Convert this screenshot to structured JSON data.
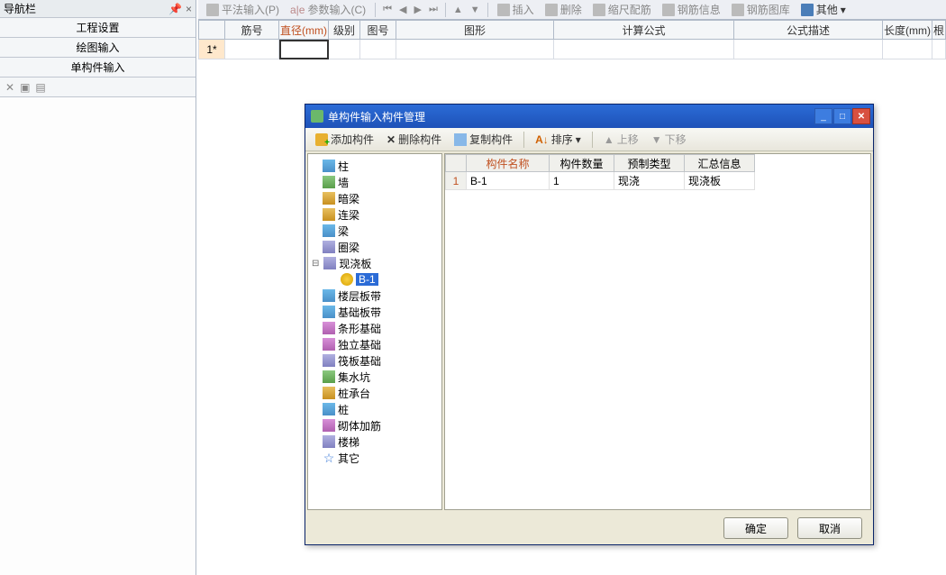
{
  "nav": {
    "title": "导航栏",
    "pin_icon": "📌",
    "close_icon": "×",
    "items": [
      "工程设置",
      "绘图输入",
      "单构件输入"
    ]
  },
  "toolbar": {
    "pingfa": "平法输入(P)",
    "canshu": "参数输入(C)",
    "insert": "插入",
    "delete": "删除",
    "suochi": "缩尺配筋",
    "gangjin_info": "钢筋信息",
    "gangjin_lib": "钢筋图库",
    "other": "其他"
  },
  "grid": {
    "headers": [
      "",
      "筋号",
      "直径(mm)",
      "级别",
      "图号",
      "图形",
      "计算公式",
      "公式描述",
      "长度(mm)",
      "根"
    ],
    "widths": [
      30,
      60,
      55,
      35,
      40,
      175,
      200,
      165,
      55,
      15
    ],
    "row1_label": "1*"
  },
  "dialog": {
    "title": "单构件输入构件管理",
    "toolbar": {
      "add": "添加构件",
      "delete": "删除构件",
      "copy": "复制构件",
      "sort": "排序",
      "up": "上移",
      "down": "下移"
    },
    "tree": [
      {
        "label": "柱",
        "ico": "ti-col"
      },
      {
        "label": "墙",
        "ico": "ti-wall"
      },
      {
        "label": "暗梁",
        "ico": "ti-beam"
      },
      {
        "label": "连梁",
        "ico": "ti-beam"
      },
      {
        "label": "梁",
        "ico": "ti-col"
      },
      {
        "label": "圈梁",
        "ico": "ti-slab"
      },
      {
        "label": "现浇板",
        "ico": "ti-slab",
        "expanded": true,
        "children": [
          {
            "label": "B-1",
            "ico": "ti-gear",
            "selected": true
          }
        ]
      },
      {
        "label": "楼层板带",
        "ico": "ti-col"
      },
      {
        "label": "基础板带",
        "ico": "ti-col"
      },
      {
        "label": "条形基础",
        "ico": "ti-found"
      },
      {
        "label": "独立基础",
        "ico": "ti-found"
      },
      {
        "label": "筏板基础",
        "ico": "ti-slab"
      },
      {
        "label": "集水坑",
        "ico": "ti-wall"
      },
      {
        "label": "桩承台",
        "ico": "ti-beam"
      },
      {
        "label": "桩",
        "ico": "ti-col"
      },
      {
        "label": "砌体加筋",
        "ico": "ti-found"
      },
      {
        "label": "楼梯",
        "ico": "ti-slab"
      },
      {
        "label": "其它",
        "ico": "ti-star"
      }
    ],
    "grid_headers": [
      "",
      "构件名称",
      "构件数量",
      "预制类型",
      "汇总信息"
    ],
    "grid_widths": [
      24,
      92,
      72,
      78,
      78
    ],
    "grid_rows": [
      {
        "n": "1",
        "name": "B-1",
        "qty": "1",
        "type": "现浇",
        "sum": "现浇板"
      }
    ],
    "ok": "确定",
    "cancel": "取消"
  }
}
